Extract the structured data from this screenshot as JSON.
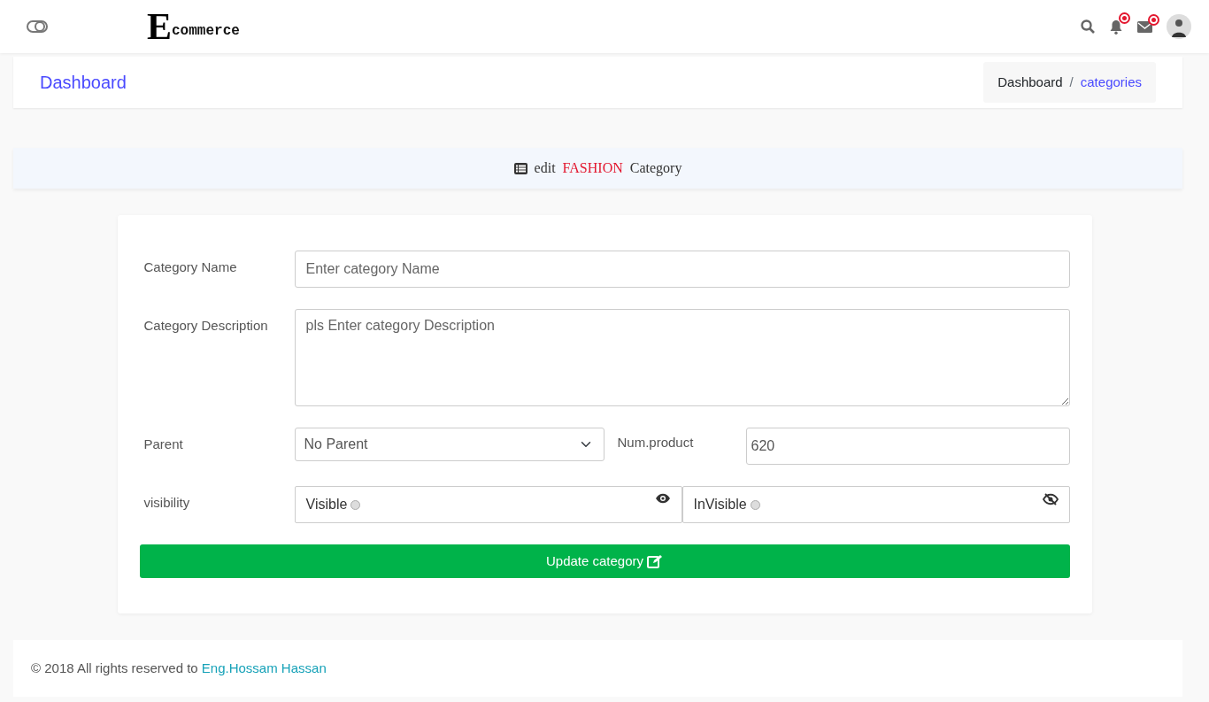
{
  "navbar": {
    "logo_initial": "E",
    "logo_rest": "commerce",
    "notifications": {
      "unread": true
    },
    "messages": {
      "unread": true
    }
  },
  "page_header": {
    "title": "Dashboard",
    "separator": "/",
    "breadcrumb": [
      {
        "label": "Dashboard",
        "active": false
      },
      {
        "label": "categories",
        "active": true
      }
    ]
  },
  "banner": {
    "prefix": "edit",
    "highlight": "FASHION",
    "suffix": "Category"
  },
  "form": {
    "fields": [
      {
        "kind": "text",
        "label": "Category Name",
        "placeholder": "Enter category Name"
      },
      {
        "kind": "textarea",
        "label": "Category Description",
        "placeholder": "pls Enter category Description"
      }
    ],
    "parent": {
      "label": "Parent",
      "value": "No Parent"
    },
    "num_product": {
      "label": "Num.product",
      "value": "620"
    },
    "visibility": {
      "label": "visibility",
      "options": [
        {
          "label": "Visible",
          "kind": "shown",
          "selected": false
        },
        {
          "label": "InVisible",
          "kind": "hidden",
          "selected": false
        }
      ]
    },
    "submit": "Update category"
  },
  "footer": {
    "text": "© 2018 All rights reserved to ",
    "link": "Eng.Hossam Hassan"
  }
}
